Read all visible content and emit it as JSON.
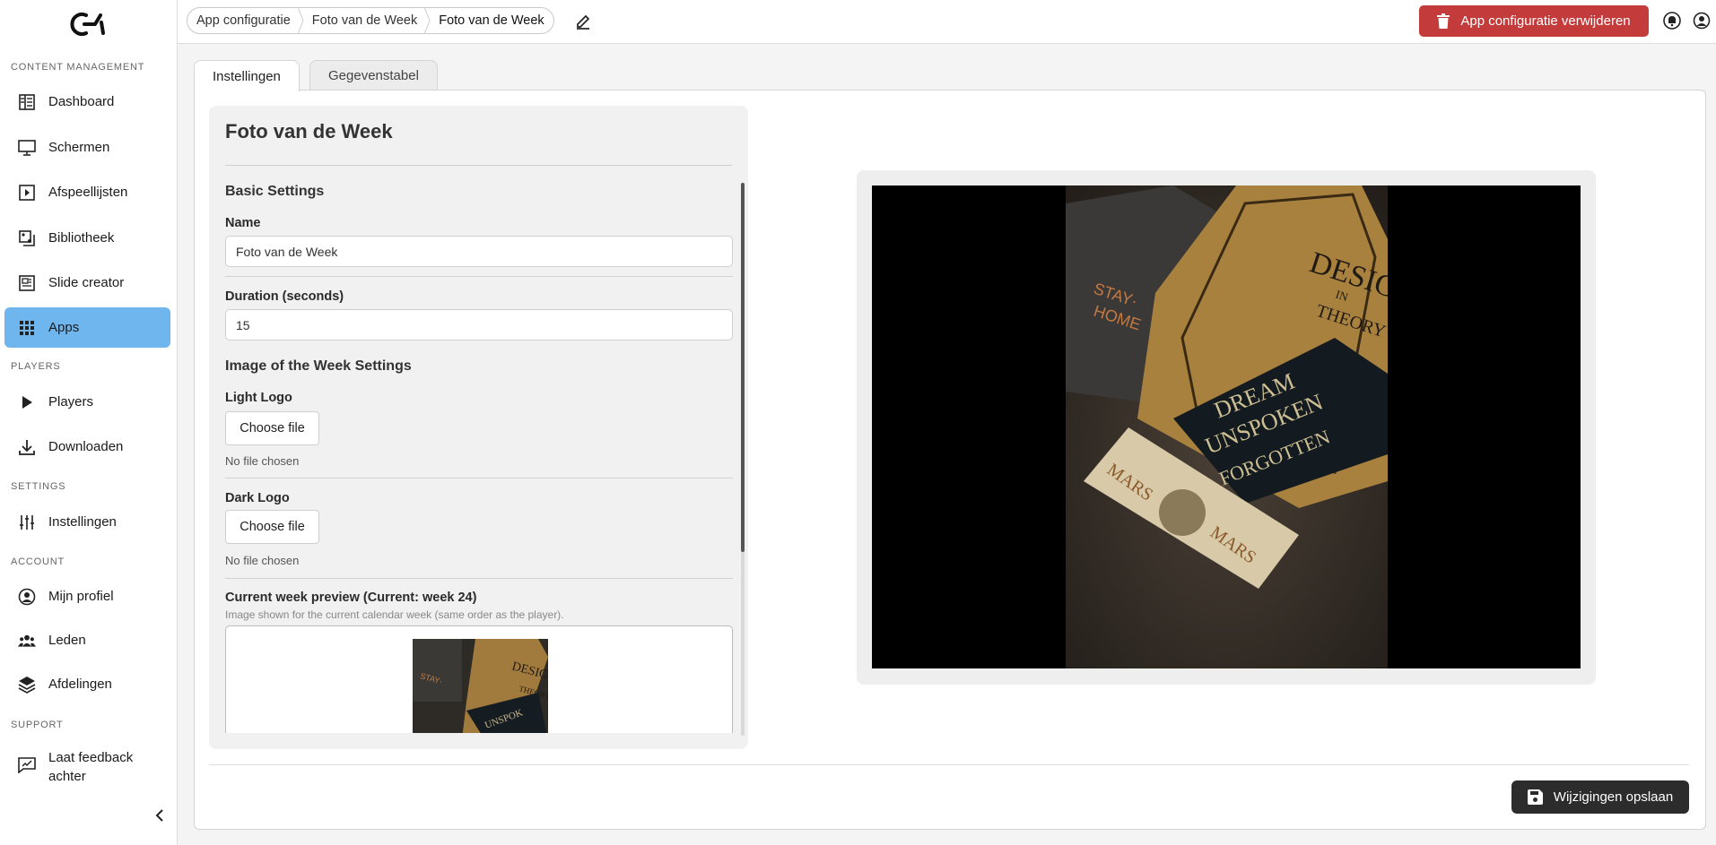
{
  "sidebar": {
    "sections": {
      "content": "CONTENT MANAGEMENT",
      "players": "PLAYERS",
      "settings": "SETTINGS",
      "account": "ACCOUNT",
      "support": "SUPPORT"
    },
    "items": [
      {
        "label": "Dashboard",
        "icon": "dashboard-icon"
      },
      {
        "label": "Schermen",
        "icon": "monitor-icon"
      },
      {
        "label": "Afspeellijsten",
        "icon": "playlist-icon"
      },
      {
        "label": "Bibliotheek",
        "icon": "library-icon"
      },
      {
        "label": "Slide creator",
        "icon": "slide-creator-icon"
      },
      {
        "label": "Apps",
        "icon": "apps-grid-icon",
        "active": true
      },
      {
        "label": "Players",
        "icon": "play-icon"
      },
      {
        "label": "Downloaden",
        "icon": "download-icon"
      },
      {
        "label": "Instellingen",
        "icon": "sliders-icon"
      },
      {
        "label": "Mijn profiel",
        "icon": "profile-icon"
      },
      {
        "label": "Leden",
        "icon": "members-icon"
      },
      {
        "label": "Afdelingen",
        "icon": "layers-icon"
      },
      {
        "label": "Laat feedback achter",
        "icon": "feedback-icon"
      }
    ]
  },
  "topbar": {
    "breadcrumb": [
      "App configuratie",
      "Foto van de Week",
      "Foto van de Week"
    ],
    "delete_label": "App configuratie verwijderen",
    "colors": {
      "danger": "#c33b3b",
      "active_nav": "#6fb5ee"
    }
  },
  "tabs": [
    {
      "label": "Instellingen",
      "active": true
    },
    {
      "label": "Gegevenstabel",
      "active": false
    }
  ],
  "form": {
    "title": "Foto van de Week",
    "basic_heading": "Basic Settings",
    "name_label": "Name",
    "name_value": "Foto van de Week",
    "duration_label": "Duration (seconds)",
    "duration_value": "15",
    "iotw_heading": "Image of the Week Settings",
    "light_logo_label": "Light Logo",
    "dark_logo_label": "Dark Logo",
    "choose_file": "Choose file",
    "no_file": "No file chosen",
    "preview_label": "Current week preview (Current: week 24)",
    "preview_hint": "Image shown for the current calendar week (same order as the player)."
  },
  "actions": {
    "save_label": "Wijzigingen opslaan"
  }
}
